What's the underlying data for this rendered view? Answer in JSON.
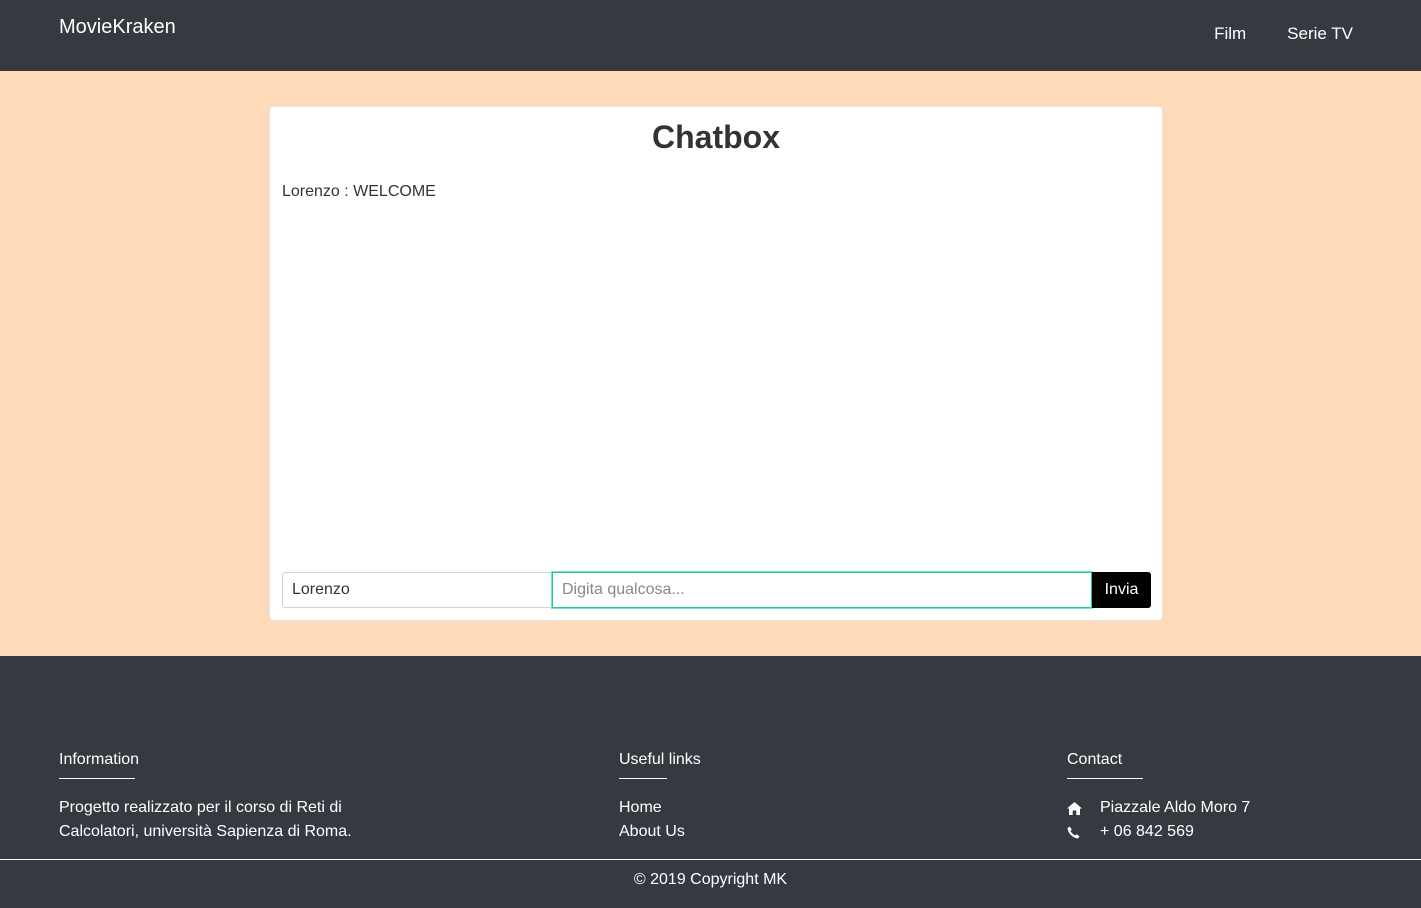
{
  "navbar": {
    "brand": "MovieKraken",
    "links": [
      "Film",
      "Serie TV"
    ]
  },
  "chat": {
    "title": "Chatbox",
    "messages": [
      {
        "text": "Lorenzo : WELCOME"
      }
    ],
    "name_value": "Lorenzo",
    "message_placeholder": "Digita qualcosa...",
    "send_label": "Invia"
  },
  "footer": {
    "information": {
      "heading": "Information",
      "text": "Progetto realizzato per il corso di Reti di Calcolatori, università Sapienza di Roma."
    },
    "useful_links": {
      "heading": "Useful links",
      "links": [
        "Home",
        "About Us"
      ]
    },
    "contact": {
      "heading": "Contact",
      "address": "Piazzale Aldo Moro 7",
      "phone": "+ 06 842 569",
      "address_icon": "home-icon",
      "phone_icon": "phone-icon"
    },
    "copyright": "© 2019 Copyright MK"
  },
  "colors": {
    "navbar_bg": "#343a40",
    "page_bg": "#ffdab9",
    "send_button_bg": "#000000",
    "focus_border": "#20c997"
  }
}
